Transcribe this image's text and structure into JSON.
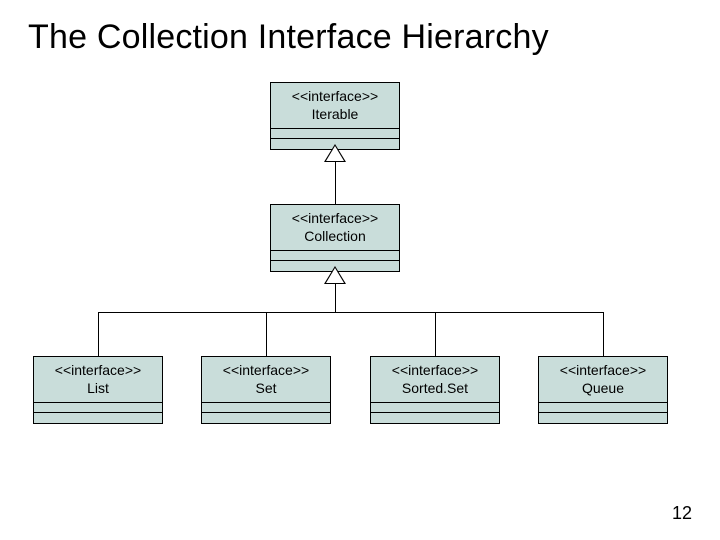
{
  "title": "The Collection Interface Hierarchy",
  "page_number": "12",
  "stereotype": "<<interface>>",
  "nodes": {
    "iterable": {
      "name": "Iterable"
    },
    "collection": {
      "name": "Collection"
    },
    "list": {
      "name": "List"
    },
    "set": {
      "name": "Set"
    },
    "sortedset": {
      "name": "Sorted.Set"
    },
    "queue": {
      "name": "Queue"
    }
  },
  "chart_data": {
    "type": "diagram",
    "title": "The Collection Interface Hierarchy",
    "notation": "UML interface hierarchy (generalization arrows point to parent)",
    "nodes": [
      {
        "id": "Iterable",
        "stereotype": "interface"
      },
      {
        "id": "Collection",
        "stereotype": "interface"
      },
      {
        "id": "List",
        "stereotype": "interface"
      },
      {
        "id": "Set",
        "stereotype": "interface"
      },
      {
        "id": "Sorted.Set",
        "stereotype": "interface"
      },
      {
        "id": "Queue",
        "stereotype": "interface"
      }
    ],
    "edges": [
      {
        "from": "Collection",
        "to": "Iterable",
        "relation": "extends"
      },
      {
        "from": "List",
        "to": "Collection",
        "relation": "extends"
      },
      {
        "from": "Set",
        "to": "Collection",
        "relation": "extends"
      },
      {
        "from": "Sorted.Set",
        "to": "Collection",
        "relation": "extends"
      },
      {
        "from": "Queue",
        "to": "Collection",
        "relation": "extends"
      }
    ]
  }
}
